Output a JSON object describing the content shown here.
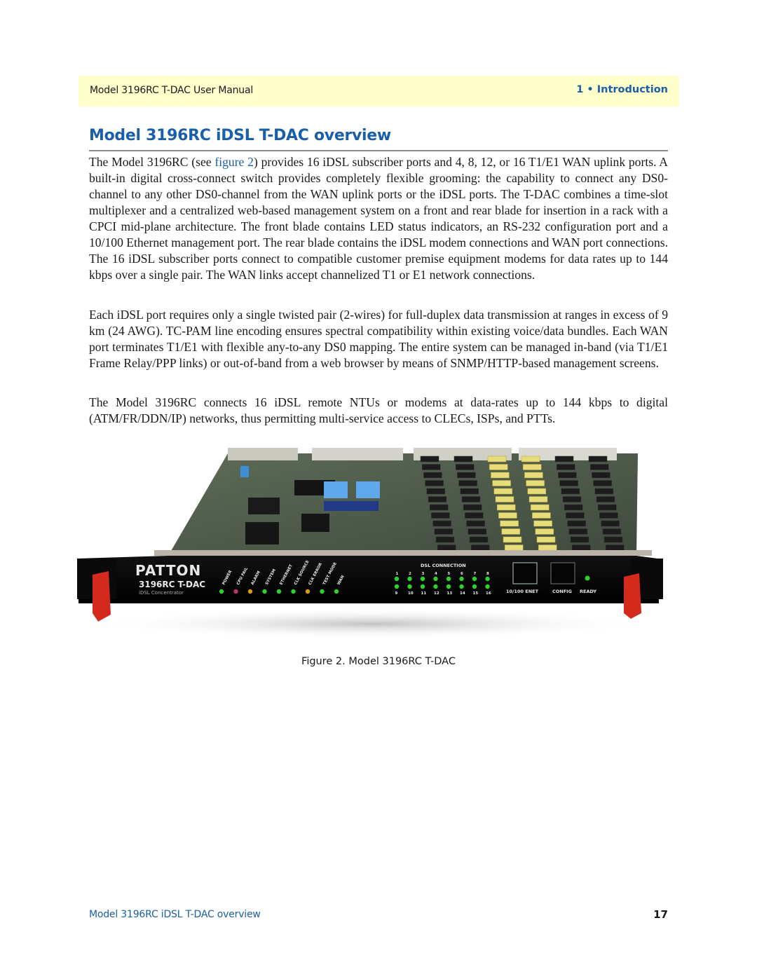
{
  "header": {
    "manual_title": "Model 3196RC T-DAC User Manual",
    "chapter": "1 • Introduction"
  },
  "section": {
    "title": "Model 3196RC iDSL T-DAC overview"
  },
  "paragraphs": {
    "p1": {
      "before_link": "The Model 3196RC (see ",
      "link_text": "figure 2",
      "after_link": ") provides 16 iDSL subscriber ports and 4, 8, 12, or 16 T1/E1 WAN uplink ports. A built-in digital cross-connect switch provides completely flexible grooming: the capability to connect any DS0-channel to any other DS0-channel from the WAN uplink ports or the iDSL ports. The T-DAC com­bines a time-slot multiplexer and a centralized web-based management system on a front and rear blade for insertion in a rack with a CPCI mid-plane architecture. The front blade contains LED status indicators, an RS-232 configuration port and a 10/100 Ethernet management port. The rear blade contains the iDSL modem connections and WAN port connections. The 16 iDSL subscriber ports connect to compatible customer premise equipment modems for data rates up to 144 kbps over a single pair. The WAN links accept channel­ized T1 or E1 network connections."
    },
    "p2": "Each iDSL port requires only a single twisted pair (2-wires) for full-duplex data transmission at ranges in excess of 9 km (24 AWG). TC-PAM line encoding ensures spectral compatibility within existing voice/data bundles. Each WAN port terminates T1/E1 with flexible any-to-any DS0 mapping. The entire system can be managed in-band (via T1/E1 Frame Relay/PPP links) or out-of-band from a web browser by means of SNMP/HTTP-based management screens.",
    "p3": "The Model 3196RC connects 16 iDSL remote NTUs or modems at data-rates up to 144 kbps to digital (ATM/FR/DDN/IP) networks, thus permitting multi-service access to CLECs, ISPs, and PTTs."
  },
  "figure": {
    "caption": "Figure 2. Model 3196RC T-DAC",
    "panel": {
      "brand": "PATTON",
      "model": "3196RC T-DAC",
      "subtitle": "iDSL Concentrator",
      "status_leds": [
        {
          "label": "POWER",
          "color": "#2fd12f"
        },
        {
          "label": "CPU FAIL",
          "color": "#c0306a"
        },
        {
          "label": "ALARM",
          "color": "#d99a1a"
        },
        {
          "label": "SYSTEM",
          "color": "#2fd12f"
        },
        {
          "label": "ETHERNET",
          "color": "#2fd12f"
        },
        {
          "label": "CLK SOURCE",
          "color": "#2fd12f"
        },
        {
          "label": "CLK ERROR",
          "color": "#d99a1a"
        },
        {
          "label": "TEST MODE",
          "color": "#2fd12f"
        },
        {
          "label": "WAN",
          "color": "#2fd12f"
        }
      ],
      "dsl_heading": "DSL CONNECTION",
      "dsl_top_labels": [
        "1",
        "2",
        "3",
        "4",
        "5",
        "6",
        "7",
        "8"
      ],
      "dsl_bottom_labels": [
        "9",
        "10",
        "11",
        "12",
        "13",
        "14",
        "15",
        "16"
      ],
      "dsl_led_color": "#2fd12f",
      "ports": [
        "10/100 ENET",
        "CONFIG"
      ],
      "ready_label": "READY",
      "ready_color": "#2fd12f"
    }
  },
  "footer": {
    "section_name": "Model 3196RC iDSL T-DAC overview",
    "page_number": "17"
  },
  "colors": {
    "accent": "#1a5fa8",
    "header_band": "#ffffcc",
    "ejector": "#d42a1e"
  }
}
